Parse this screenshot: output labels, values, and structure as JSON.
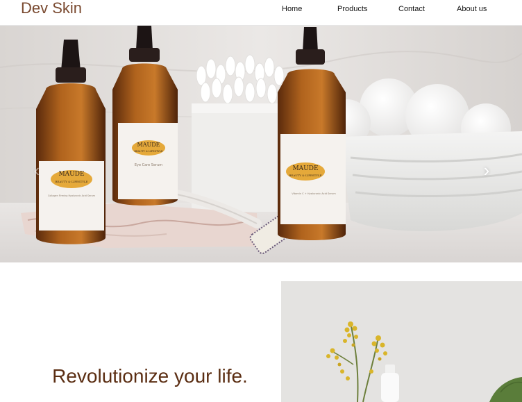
{
  "navbar": {
    "brand": "Dev Skin",
    "links": [
      {
        "label": "Home"
      },
      {
        "label": "Products"
      },
      {
        "label": "Contact"
      },
      {
        "label": "About us"
      }
    ]
  },
  "hero": {
    "prev_icon": "chevron-left-icon",
    "next_icon": "chevron-right-icon",
    "prev_glyph": "‹",
    "next_glyph": "›",
    "products": [
      {
        "brand": "MAUDE",
        "line": "BEAUTY & LIFESTYLE",
        "name": "Collagen Firming Hyaluronic Acid Serum"
      },
      {
        "brand": "MAUDE",
        "line": "BEAUTY & LIFESTYLE",
        "name": "Eye Care Serum"
      },
      {
        "brand": "MAUDE",
        "line": "BEAUTY & LIFESTYLE",
        "name": "Vitamin C + Hyaluronic Acid Serum"
      }
    ]
  },
  "feature": {
    "heading": "Revolutionize your life."
  },
  "colors": {
    "brand": "#7a4a30",
    "heading": "#5b2e13",
    "amber": "#b0631d",
    "label_gold": "#e5a93a"
  }
}
